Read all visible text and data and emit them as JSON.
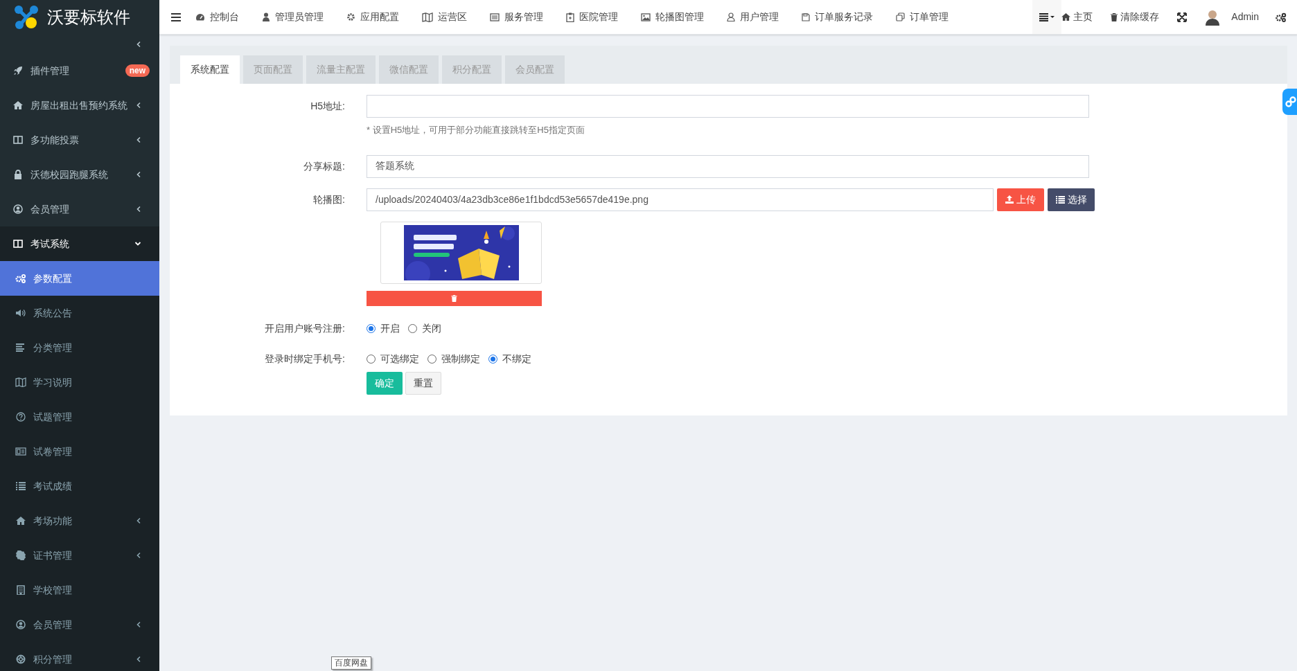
{
  "brand": {
    "name": "沃要标软件"
  },
  "sidebar": {
    "items": [
      {
        "kind": "group",
        "expanded": false,
        "selected": false
      },
      {
        "label": "插件管理",
        "kind": "link",
        "badge": "new",
        "selected": false
      },
      {
        "label": "房屋出租出售预约系统",
        "kind": "group",
        "expanded": false,
        "selected": false
      },
      {
        "label": "多功能投票",
        "kind": "group",
        "expanded": false,
        "selected": false
      },
      {
        "label": "沃德校园跑腿系统",
        "kind": "group",
        "expanded": false,
        "selected": false
      },
      {
        "label": "会员管理",
        "kind": "group",
        "expanded": false,
        "selected": false
      },
      {
        "label": "考试系统",
        "kind": "group",
        "expanded": true,
        "selected": false,
        "children": [
          {
            "label": "参数配置",
            "kind": "link",
            "selected": true
          },
          {
            "label": "系统公告",
            "kind": "link",
            "selected": false
          },
          {
            "label": "分类管理",
            "kind": "link",
            "selected": false
          },
          {
            "label": "学习说明",
            "kind": "link",
            "selected": false
          },
          {
            "label": "试题管理",
            "kind": "link",
            "selected": false
          },
          {
            "label": "试卷管理",
            "kind": "link",
            "selected": false
          },
          {
            "label": "考试成绩",
            "kind": "link",
            "selected": false
          },
          {
            "label": "考场功能",
            "kind": "group",
            "expanded": false,
            "selected": false
          },
          {
            "label": "证书管理",
            "kind": "group",
            "expanded": false,
            "selected": false
          },
          {
            "label": "学校管理",
            "kind": "link",
            "selected": false
          },
          {
            "label": "会员管理",
            "kind": "group",
            "expanded": false,
            "selected": false
          },
          {
            "label": "积分管理",
            "kind": "group",
            "expanded": false,
            "selected": false
          }
        ]
      }
    ]
  },
  "top_nav": {
    "items": [
      "控制台",
      "管理员管理",
      "应用配置",
      "运营区",
      "服务管理",
      "医院管理",
      "轮播图管理",
      "用户管理",
      "订单服务记录",
      "订单管理"
    ],
    "right": {
      "home": "主页",
      "clear_cache": "清除缓存",
      "user": "Admin"
    }
  },
  "tabs": [
    {
      "label": "系统配置",
      "selected": true
    },
    {
      "label": "页面配置",
      "selected": false
    },
    {
      "label": "流量主配置",
      "selected": false
    },
    {
      "label": "微信配置",
      "selected": false
    },
    {
      "label": "积分配置",
      "selected": false
    },
    {
      "label": "会员配置",
      "selected": false
    }
  ],
  "form": {
    "h5_url": {
      "label": "H5地址:",
      "help": "* 设置H5地址，可用于部分功能直接跳转至H5指定页面"
    },
    "share_title": {
      "label": "分享标题:",
      "value": "答题系统"
    },
    "carousel": {
      "label": "轮播图:",
      "value": "/uploads/20240403/4a23db3ce86e1f1bdcd53e5657de419e.png",
      "upload": "上传",
      "choose": "选择"
    },
    "radios": [
      {
        "label": "开启用户账号注册:",
        "options": [
          {
            "label": "开启",
            "selected": true
          },
          {
            "label": "关闭",
            "selected": false
          }
        ]
      },
      {
        "label": "登录时绑定手机号:",
        "options": [
          {
            "label": "可选绑定",
            "selected": false
          },
          {
            "label": "强制绑定",
            "selected": false
          },
          {
            "label": "不绑定",
            "selected": true
          }
        ]
      }
    ],
    "submit": "确定",
    "reset": "重置"
  },
  "tooltip": "百度网盘"
}
